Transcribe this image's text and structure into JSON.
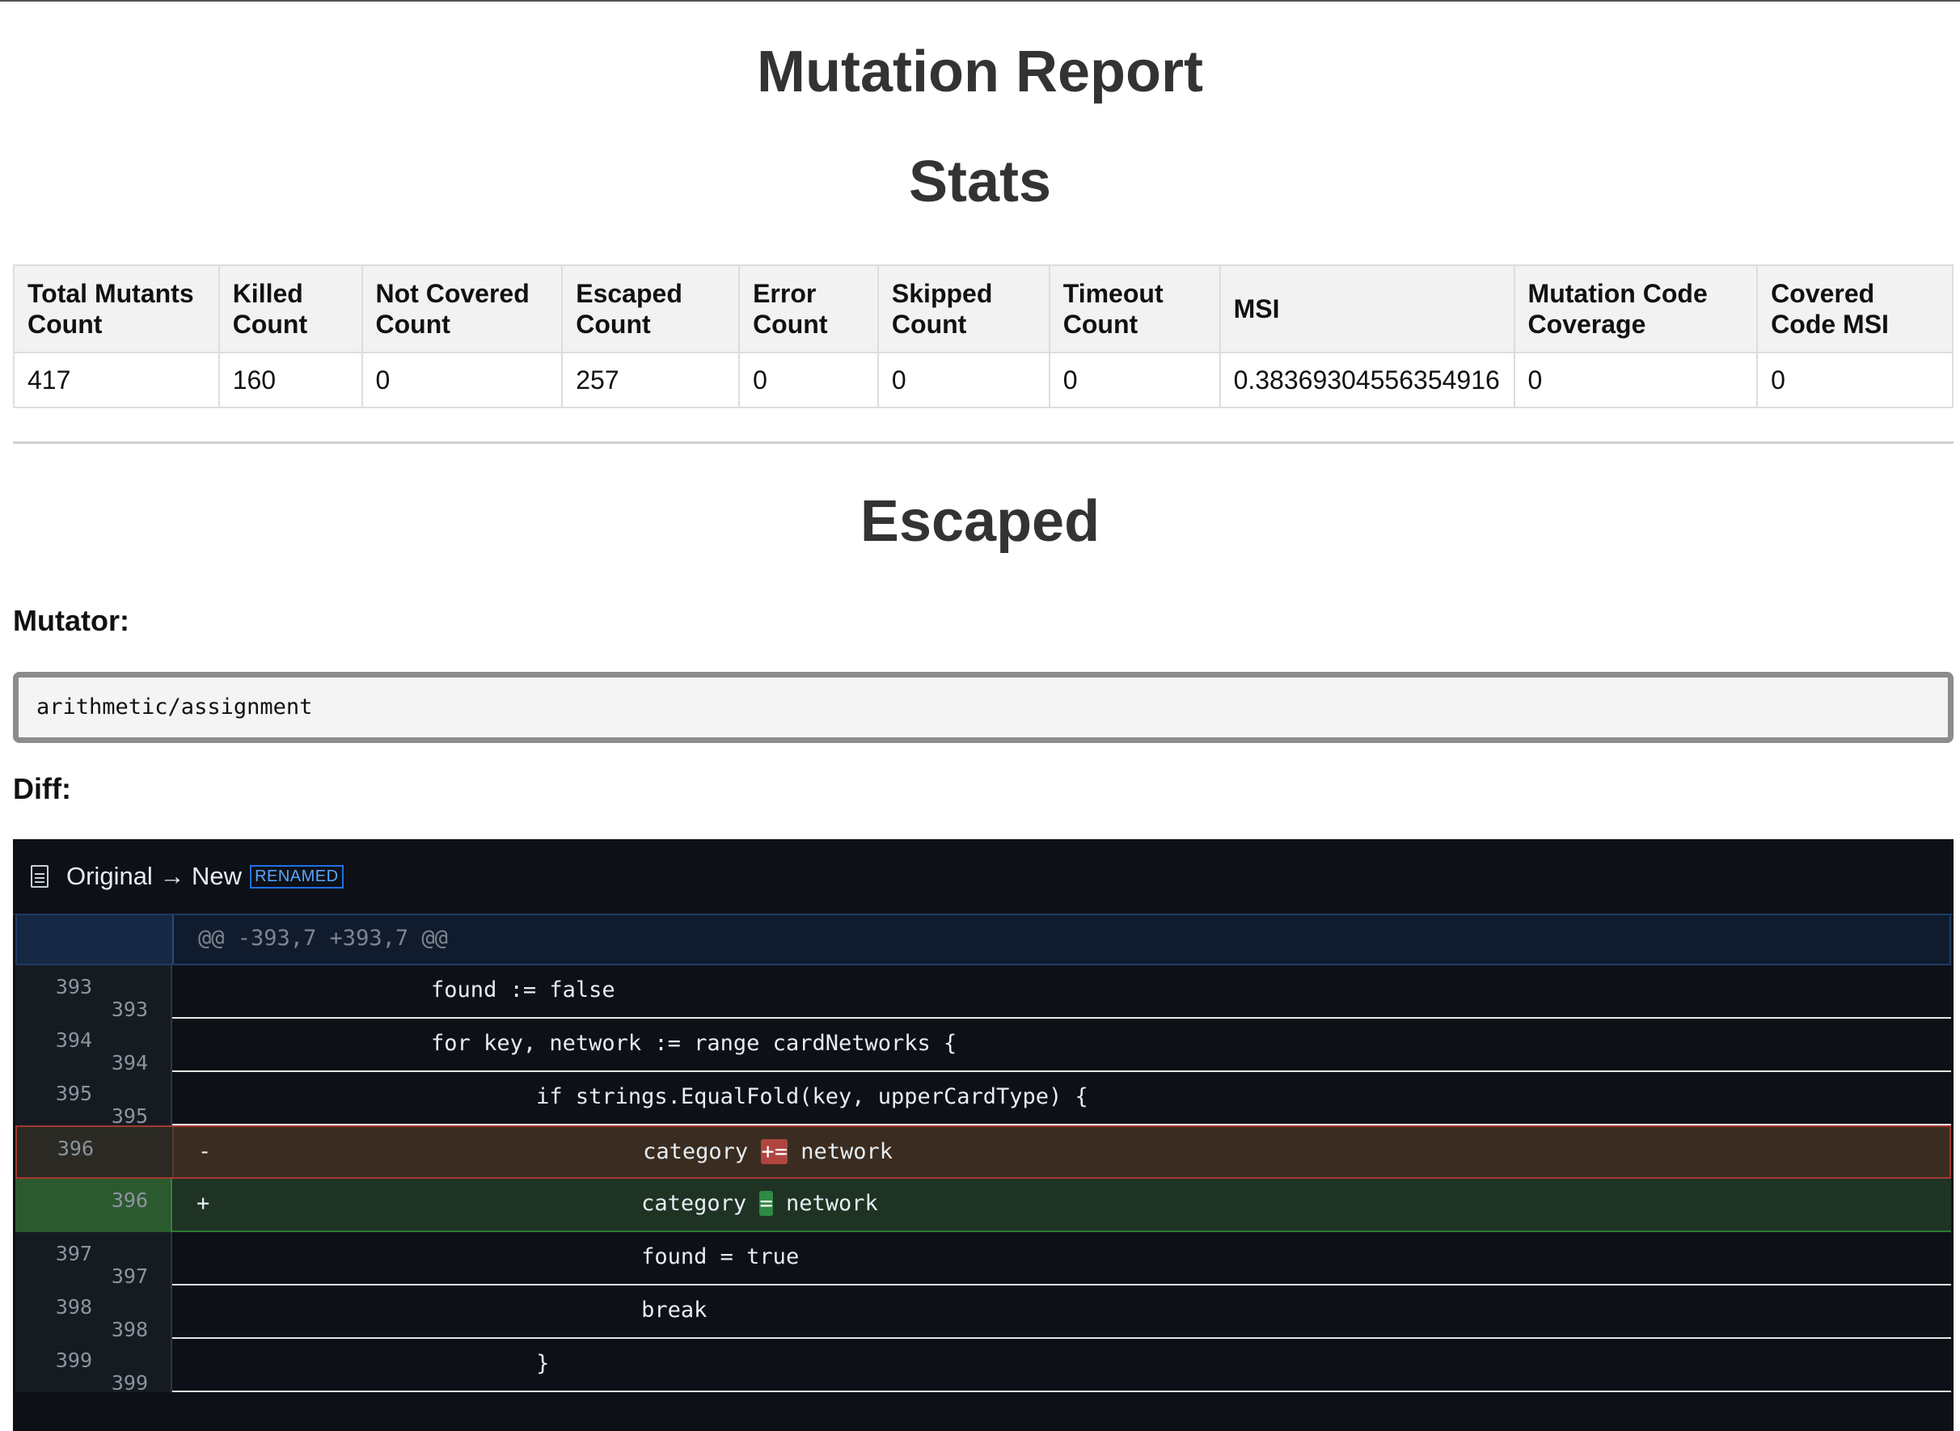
{
  "page": {
    "title": "Mutation Report"
  },
  "stats": {
    "heading": "Stats",
    "headers": [
      "Total Mutants Count",
      "Killed Count",
      "Not Covered Count",
      "Escaped Count",
      "Error Count",
      "Skipped Count",
      "Timeout Count",
      "MSI",
      "Mutation Code Coverage",
      "Covered Code MSI"
    ],
    "values": [
      "417",
      "160",
      "0",
      "257",
      "0",
      "0",
      "0",
      "0.38369304556354916",
      "0",
      "0"
    ]
  },
  "escaped": {
    "heading": "Escaped",
    "mutator_label": "Mutator:",
    "mutator_value": "arithmetic/assignment",
    "diff_label": "Diff:"
  },
  "diff": {
    "file_title": "Original → New",
    "badge": "RENAMED",
    "hunk_header": "@@ -393,7 +393,7 @@",
    "lines": [
      {
        "old": "393",
        "new": "393",
        "marker": "",
        "pre": "        found := false",
        "hl": "",
        "post": ""
      },
      {
        "old": "394",
        "new": "394",
        "marker": "",
        "pre": "        for key, network := range cardNetworks {",
        "hl": "",
        "post": ""
      },
      {
        "old": "395",
        "new": "395",
        "marker": "",
        "pre": "                if strings.EqualFold(key, upperCardType) {",
        "hl": "",
        "post": ""
      },
      {
        "old": "396",
        "new": "",
        "marker": "-",
        "pre": "                        category ",
        "hl": "+=",
        "post": " network"
      },
      {
        "old": "",
        "new": "396",
        "marker": "+",
        "pre": "                        category ",
        "hl": "=",
        "post": " network"
      },
      {
        "old": "397",
        "new": "397",
        "marker": "",
        "pre": "                        found = true",
        "hl": "",
        "post": ""
      },
      {
        "old": "398",
        "new": "398",
        "marker": "",
        "pre": "                        break",
        "hl": "",
        "post": ""
      },
      {
        "old": "399",
        "new": "399",
        "marker": "",
        "pre": "                }",
        "hl": "",
        "post": ""
      }
    ]
  },
  "colors": {
    "diff_background": "#0d1117",
    "deleted_highlight": "#b0453f",
    "added_highlight": "#2f8a43",
    "badge_blue": "#58a6ff"
  },
  "icons": {
    "file": "file-icon"
  }
}
